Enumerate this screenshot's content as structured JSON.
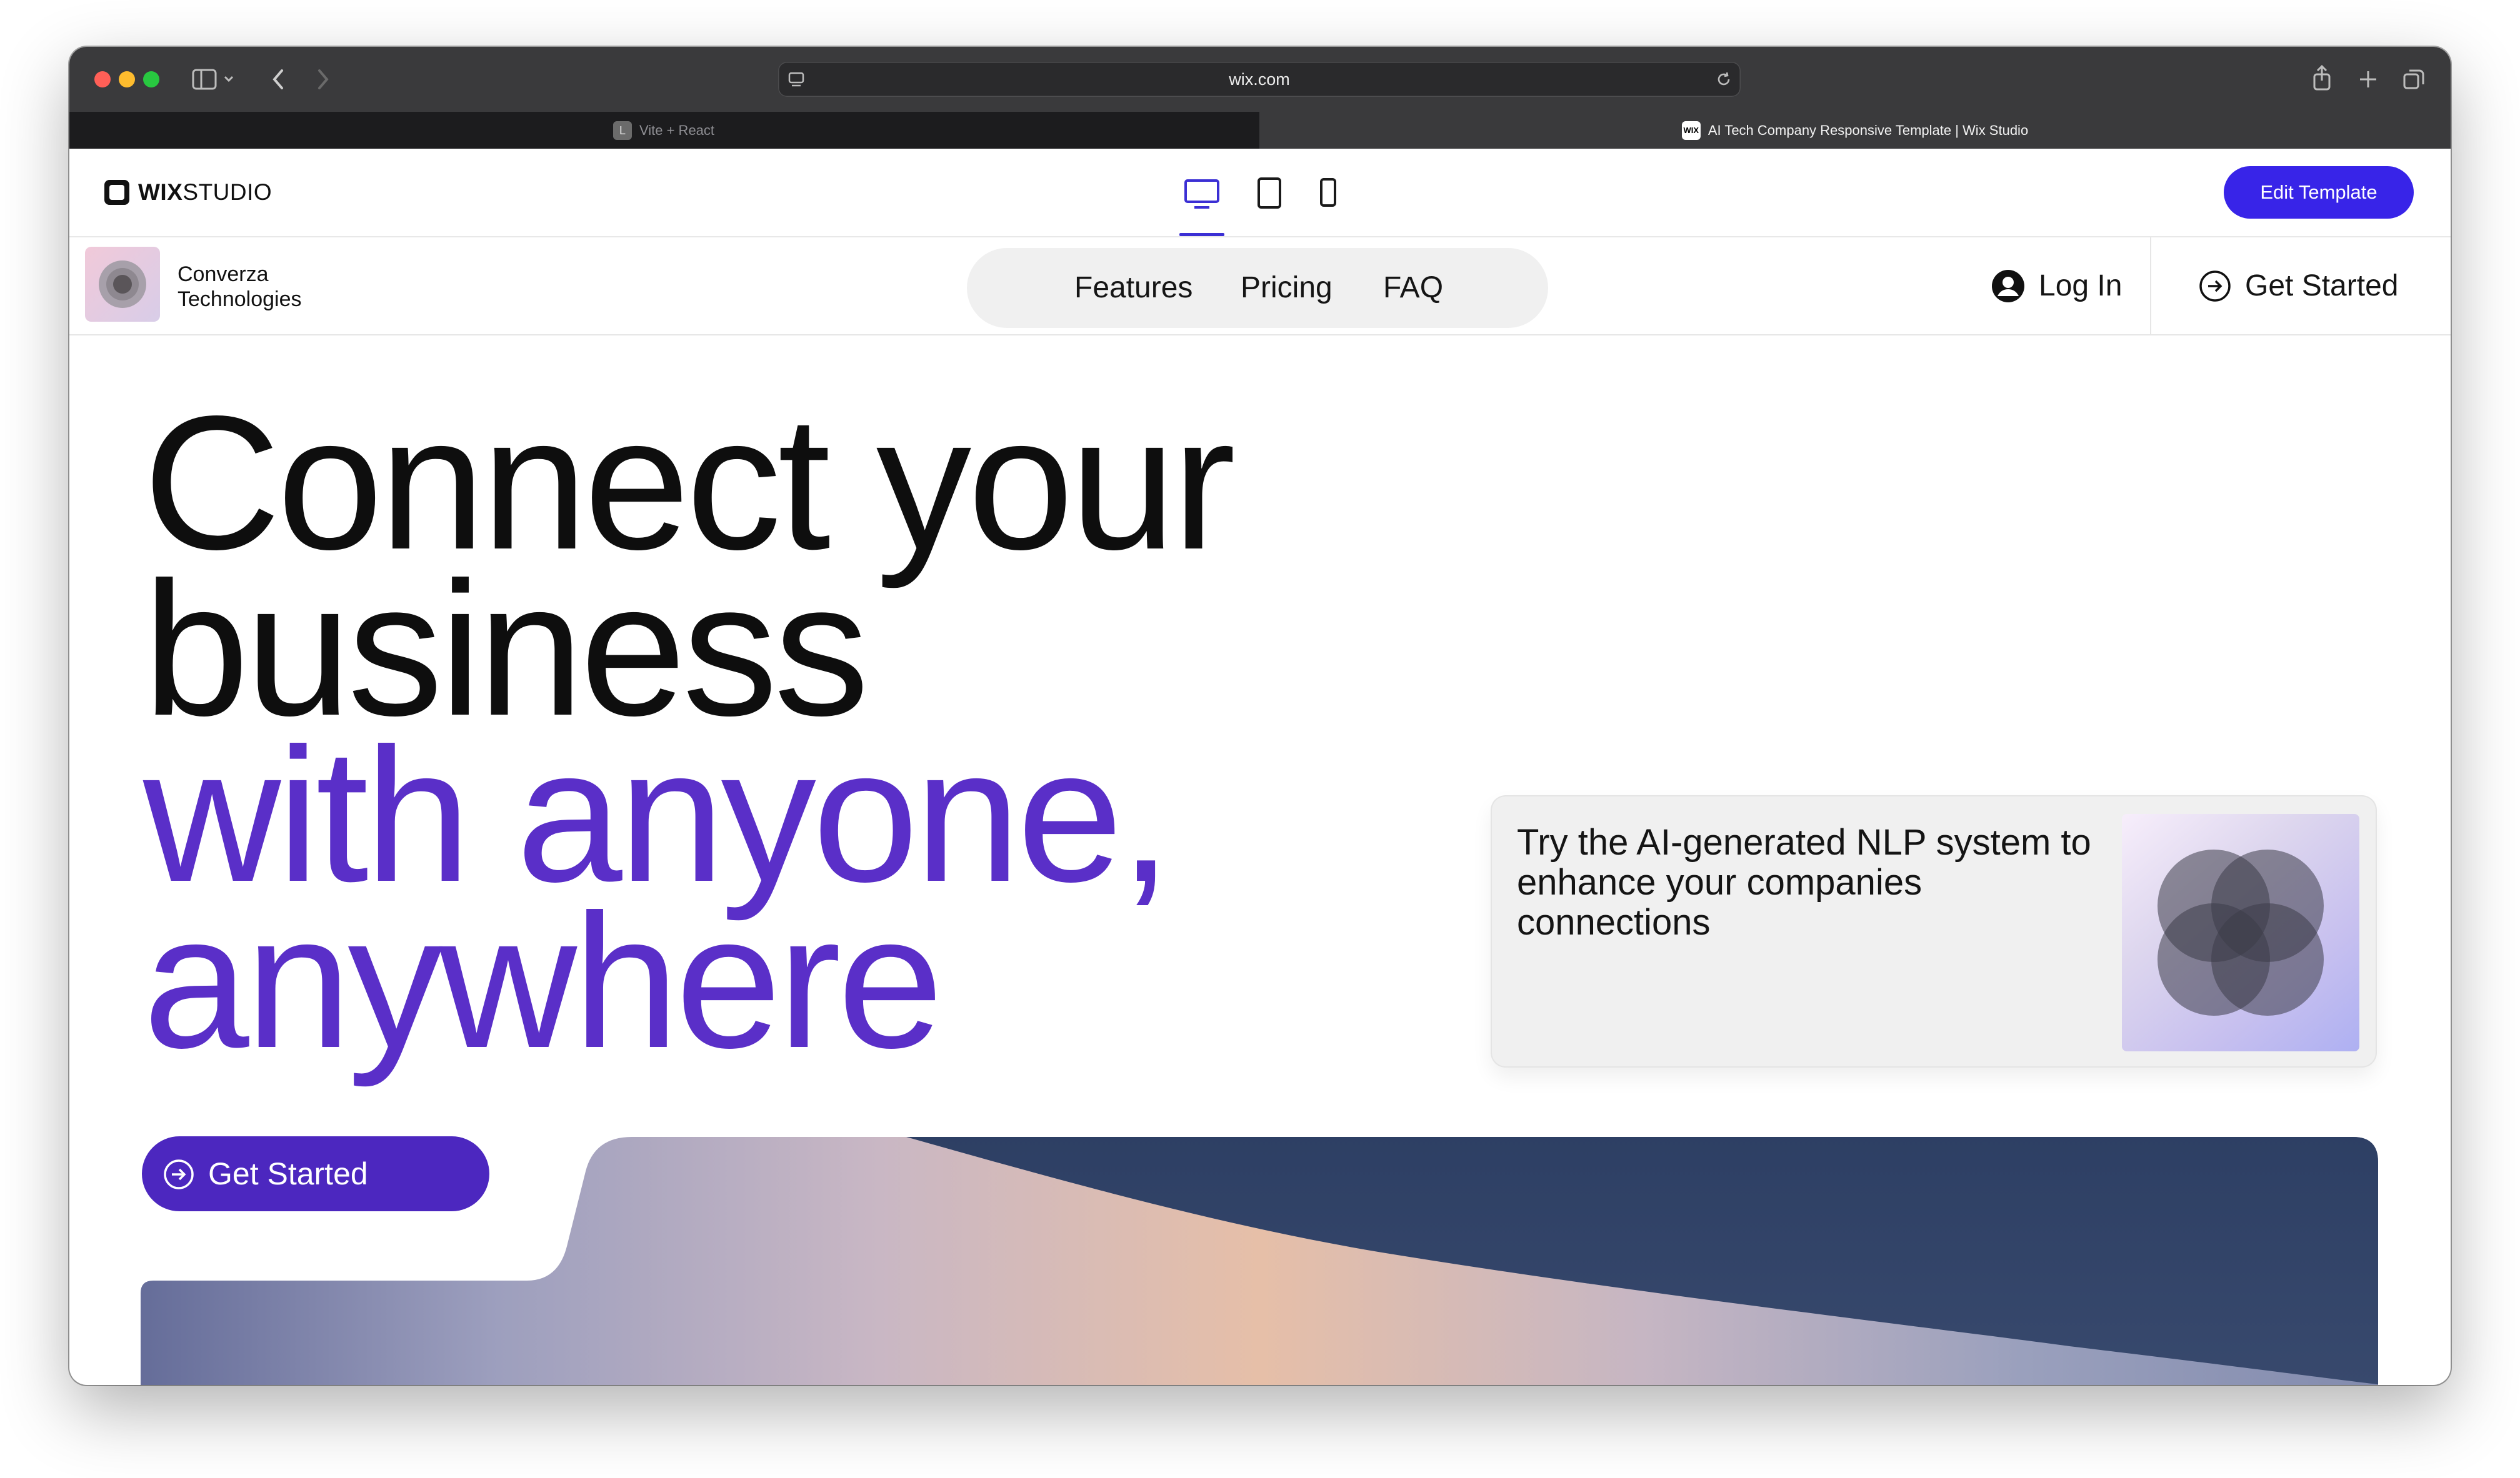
{
  "browser": {
    "url": "wix.com",
    "tabs": [
      {
        "title": "Vite + React",
        "favicon": "L"
      },
      {
        "title": "AI Tech Company Responsive Template | Wix Studio",
        "favicon": "WIX"
      }
    ]
  },
  "editor": {
    "logo_bold": "WIX",
    "logo_rest": "STUDIO",
    "devices": [
      "desktop-icon",
      "tablet-icon",
      "mobile-icon"
    ],
    "edit_button": "Edit Template",
    "accent_color": "#3824e8"
  },
  "site": {
    "brand": {
      "line1": "Converza",
      "line2": "Technologies"
    },
    "nav": [
      "Features",
      "Pricing",
      "FAQ"
    ],
    "login": "Log In",
    "get_started": "Get Started",
    "hero": {
      "line1": "Connect your",
      "line2": "business",
      "line3": "with anyone,",
      "line4": "anywhere"
    },
    "card_text": "Try the AI-generated NLP system to enhance your companies connections",
    "cta": "Get Started",
    "brand_purple": "#5a2fc8"
  }
}
